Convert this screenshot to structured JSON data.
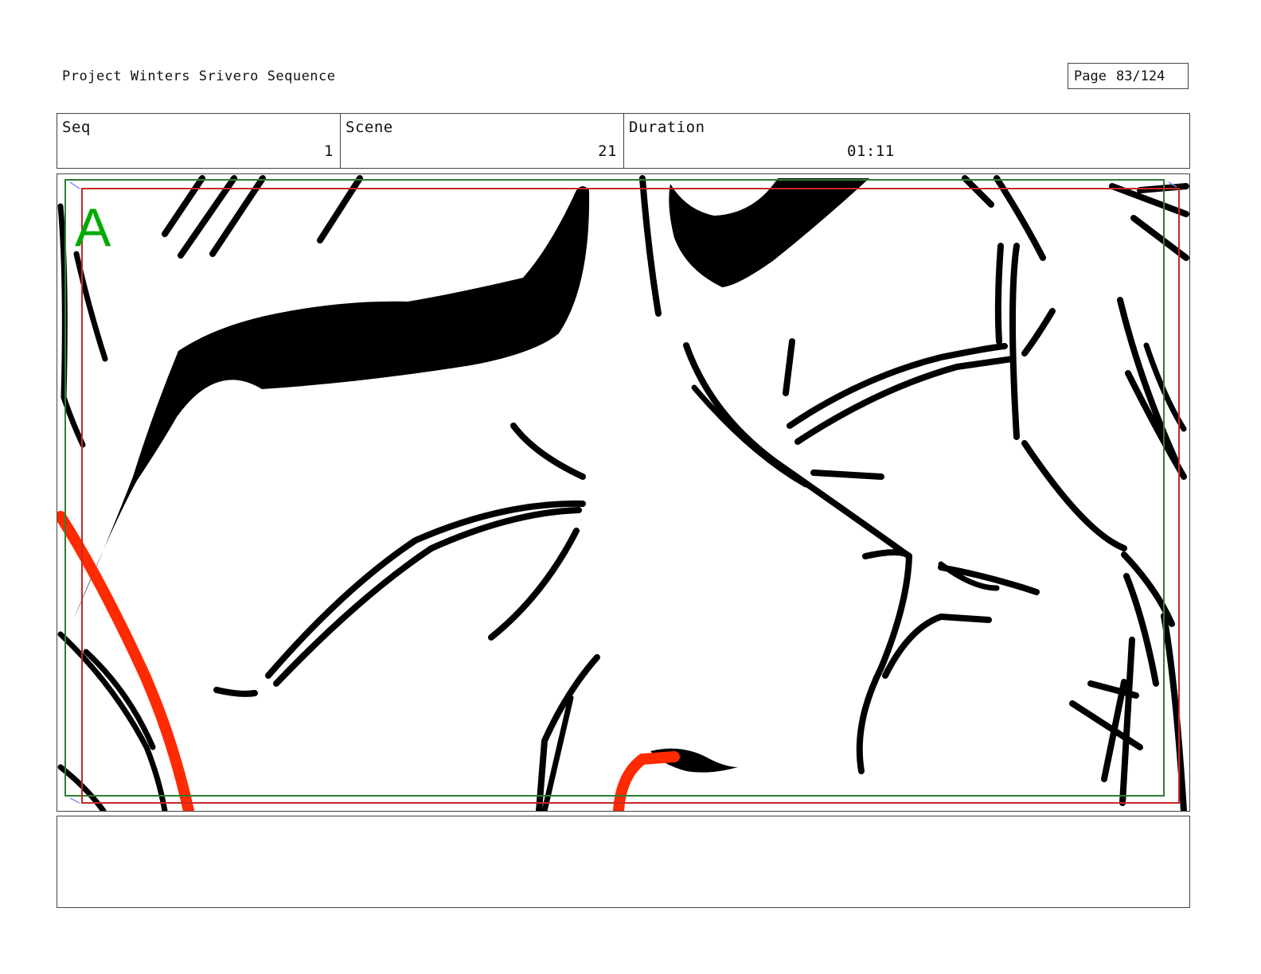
{
  "header": {
    "project_title": "Project Winters Srivero Sequence",
    "page_label": "Page",
    "page_number": "83/124"
  },
  "info": {
    "seq_label": "Seq",
    "seq_value": "1",
    "scene_label": "Scene",
    "scene_value": "21",
    "duration_label": "Duration",
    "duration_value": "01:11"
  },
  "panel": {
    "marker": "A",
    "colors": {
      "ink": "#000000",
      "accent": "#ff2a00",
      "safe_frame": "#2e7d32",
      "action_frame": "#c62828",
      "marker": "#00aa00"
    }
  },
  "notes": {
    "text": ""
  }
}
